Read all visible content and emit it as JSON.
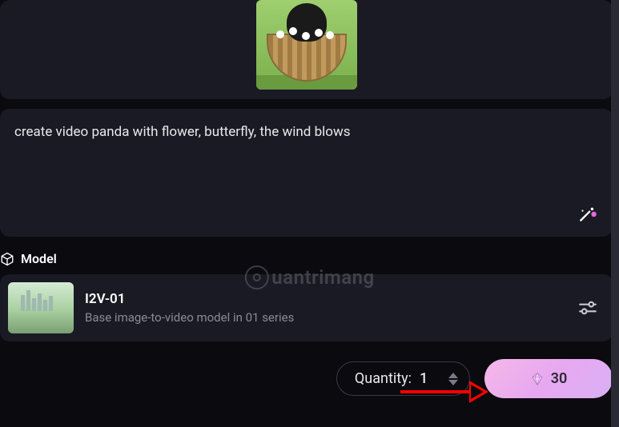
{
  "prompt": {
    "text": "create video panda with flower, butterfly,  the wind blows"
  },
  "model_section": {
    "label": "Model",
    "name": "I2V-01",
    "description": "Base image-to-video model in 01 series"
  },
  "quantity": {
    "label": "Quantity:",
    "value": "1"
  },
  "cost": {
    "value": "30"
  },
  "watermark": {
    "text": "uantrimang"
  }
}
